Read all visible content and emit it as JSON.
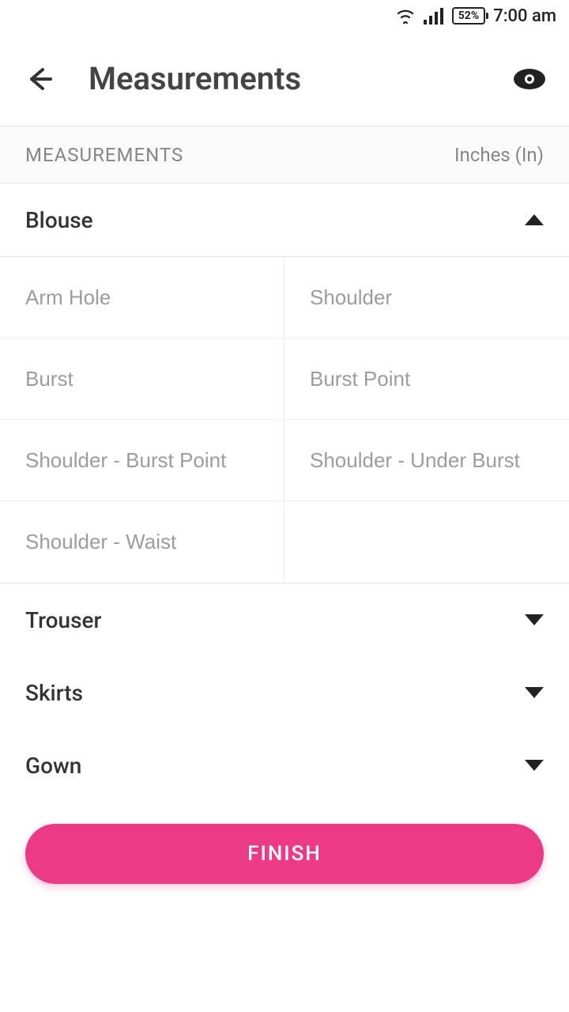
{
  "status": {
    "battery": "52%",
    "time": "7:00 am"
  },
  "header": {
    "title": "Measurements"
  },
  "subheader": {
    "label": "MEASUREMENTS",
    "unit": "Inches (In)"
  },
  "categories": [
    {
      "name": "Blouse",
      "expanded": true,
      "fields": [
        "Arm Hole",
        "Shoulder",
        "Burst",
        "Burst Point",
        "Shoulder - Burst Point",
        "Shoulder - Under Burst",
        "Shoulder - Waist",
        ""
      ]
    },
    {
      "name": "Trouser",
      "expanded": false
    },
    {
      "name": "Skirts",
      "expanded": false
    },
    {
      "name": "Gown",
      "expanded": false
    }
  ],
  "finish": "FINISH"
}
